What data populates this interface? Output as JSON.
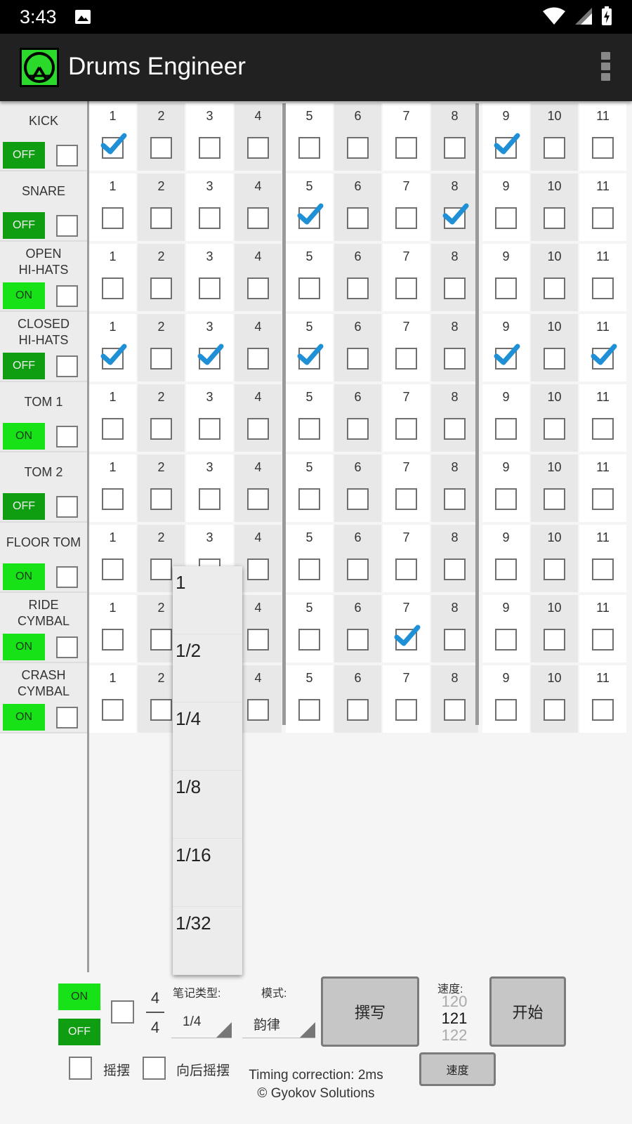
{
  "status_bar": {
    "time": "3:43"
  },
  "app": {
    "title": "Drums Engineer",
    "accent": "#17e117"
  },
  "steps": [
    "1",
    "2",
    "3",
    "4",
    "5",
    "6",
    "7",
    "8",
    "9",
    "10",
    "11"
  ],
  "tracks": [
    {
      "name": [
        "KICK"
      ],
      "toggle": "OFF",
      "checked": [
        1,
        9
      ]
    },
    {
      "name": [
        "SNARE"
      ],
      "toggle": "OFF",
      "checked": [
        5,
        8
      ]
    },
    {
      "name": [
        "OPEN",
        "HI-HATS"
      ],
      "toggle": "ON",
      "checked": []
    },
    {
      "name": [
        "CLOSED",
        "HI-HATS"
      ],
      "toggle": "OFF",
      "checked": [
        1,
        3,
        5,
        9,
        11
      ]
    },
    {
      "name": [
        "TOM 1"
      ],
      "toggle": "ON",
      "checked": []
    },
    {
      "name": [
        "TOM 2"
      ],
      "toggle": "OFF",
      "checked": []
    },
    {
      "name": [
        "FLOOR TOM"
      ],
      "toggle": "ON",
      "checked": []
    },
    {
      "name": [
        "RIDE",
        "CYMBAL"
      ],
      "toggle": "ON",
      "checked": [
        7
      ]
    },
    {
      "name": [
        "CRASH",
        "CYMBAL"
      ],
      "toggle": "ON",
      "checked": []
    }
  ],
  "note_dropdown": {
    "options": [
      "1",
      "1/2",
      "1/4",
      "1/8",
      "1/16",
      "1/32"
    ]
  },
  "bottom": {
    "on_label": "ON",
    "off_label": "OFF",
    "time_sig_top": "4",
    "time_sig_bottom": "4",
    "note_type_label": "笔记类型:",
    "note_type_value": "1/4",
    "mode_label": "模式:",
    "mode_value": "韵律",
    "compose_button": "撰写",
    "tempo_label": "速度:",
    "tempo_prev": "120",
    "tempo_current": "121",
    "tempo_next": "122",
    "start_button": "开始",
    "tempo_button": "速度",
    "swing_label": "摇摆",
    "reverse_swing_label": "向后摇摆",
    "timing_correction": "Timing correction: 2ms",
    "copyright": "© Gyokov Solutions"
  }
}
